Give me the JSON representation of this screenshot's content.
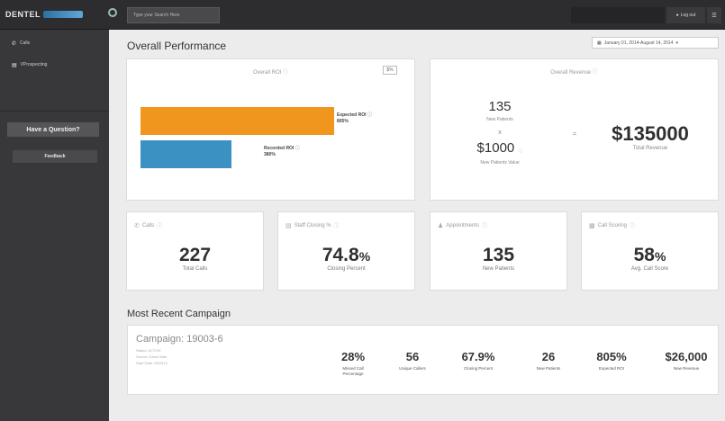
{
  "topbar": {
    "logo_text": "DENTEL",
    "search_placeholder": "Type your Search Here",
    "login_label": "Log out",
    "login_icon": "user-icon",
    "menu_icon": "menu-icon"
  },
  "sidebar": {
    "items": [
      {
        "icon": "phone-icon",
        "label": "Calls"
      },
      {
        "icon": "document-icon",
        "label": "VProspecting"
      }
    ],
    "question_label": "Have a Question?",
    "feedback_label": "Feedback"
  },
  "page": {
    "title": "Overall Performance",
    "date_range": "January 01, 2014-August 14, 2014"
  },
  "roi": {
    "title": "Overall ROI",
    "toggle_label": "$%",
    "bars": [
      {
        "name": "Expected ROI",
        "value": 805,
        "label": "Expected ROI",
        "value_text": "805%",
        "color": "#f0961e"
      },
      {
        "name": "Recorded ROI",
        "value": 380,
        "label": "Recorded ROI",
        "value_text": "380%",
        "color": "#3a91c2"
      }
    ]
  },
  "revenue": {
    "title": "Overall Revenue",
    "new_patients_value": "135",
    "new_patients_label": "New Patients",
    "times_symbol": "x",
    "patient_value": "$1000",
    "patient_value_label": "New Patients Value",
    "equals_symbol": "=",
    "total_value": "$135000",
    "total_label": "Total Revenue"
  },
  "kpis": [
    {
      "icon": "phone-icon",
      "title": "Calls",
      "value": "227",
      "unit": "",
      "sub": "Total Calls"
    },
    {
      "icon": "document-icon",
      "title": "Staff Closing %",
      "value": "74.8",
      "unit": "%",
      "sub": "Closing Percent"
    },
    {
      "icon": "person-icon",
      "title": "Appointments",
      "value": "135",
      "unit": "",
      "sub": "New Patients"
    },
    {
      "icon": "chart-icon",
      "title": "Call Scoring",
      "value": "58",
      "unit": "%",
      "sub": "Avg. Call Score"
    }
  ],
  "campaign": {
    "section_title": "Most Recent Campaign",
    "title": "Campaign: 19003-6",
    "meta": [
      "Status: ACTIVE",
      "Source: Direct Mail",
      "Start Date: 05/2014"
    ],
    "stats": [
      {
        "value": "28%",
        "label": "Missed Call Percentage"
      },
      {
        "value": "56",
        "label": "Unique Callers"
      },
      {
        "value": "67.9%",
        "label": "Closing Percent"
      },
      {
        "value": "26",
        "label": "New Patients"
      },
      {
        "value": "805%",
        "label": "Expected ROI"
      },
      {
        "value": "$26,000",
        "label": "New Revenue"
      }
    ]
  }
}
